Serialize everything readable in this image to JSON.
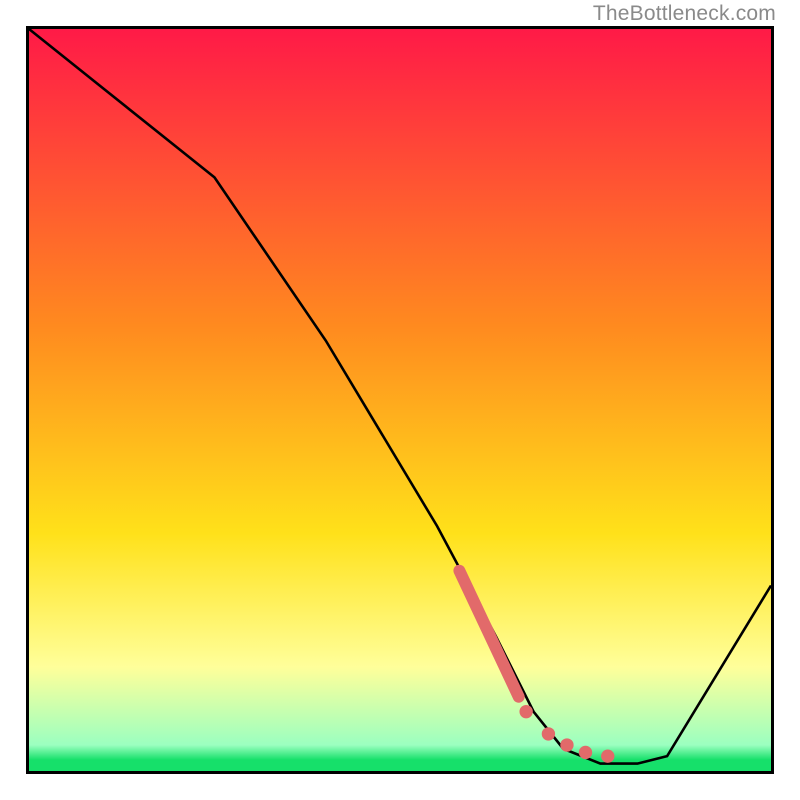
{
  "watermark": "TheBottleneck.com",
  "colors": {
    "red": "#ff1a47",
    "orange": "#ff8a1f",
    "yellow": "#ffe11a",
    "pale_yellow": "#ffff9a",
    "green": "#16e06a",
    "curve": "#000000",
    "marker": "#e26a6a",
    "border": "#000000"
  },
  "chart_data": {
    "type": "line",
    "title": "",
    "xlabel": "",
    "ylabel": "",
    "xlim": [
      0,
      100
    ],
    "ylim": [
      0,
      100
    ],
    "series": [
      {
        "name": "bottleneck-curve",
        "x": [
          0,
          10,
          25,
          40,
          55,
          63,
          68,
          72,
          77,
          82,
          86,
          100
        ],
        "y": [
          100,
          92,
          80,
          58,
          33,
          18,
          8,
          3,
          1,
          1,
          2,
          25
        ]
      }
    ],
    "markers": {
      "name": "highlight-segment",
      "segment": {
        "x0": 58,
        "y0": 27,
        "x1": 66,
        "y1": 10
      },
      "dots": [
        {
          "x": 67,
          "y": 8
        },
        {
          "x": 70,
          "y": 5
        },
        {
          "x": 72.5,
          "y": 3.5
        },
        {
          "x": 75,
          "y": 2.5
        },
        {
          "x": 78,
          "y": 2
        }
      ]
    },
    "gradient_bands": [
      {
        "pos": 0.0,
        "color": "#ff1a47"
      },
      {
        "pos": 0.4,
        "color": "#ff8a1f"
      },
      {
        "pos": 0.68,
        "color": "#ffe11a"
      },
      {
        "pos": 0.86,
        "color": "#ffff9a"
      },
      {
        "pos": 0.965,
        "color": "#9bffc0"
      },
      {
        "pos": 0.985,
        "color": "#16e06a"
      },
      {
        "pos": 1.0,
        "color": "#16e06a"
      }
    ]
  }
}
